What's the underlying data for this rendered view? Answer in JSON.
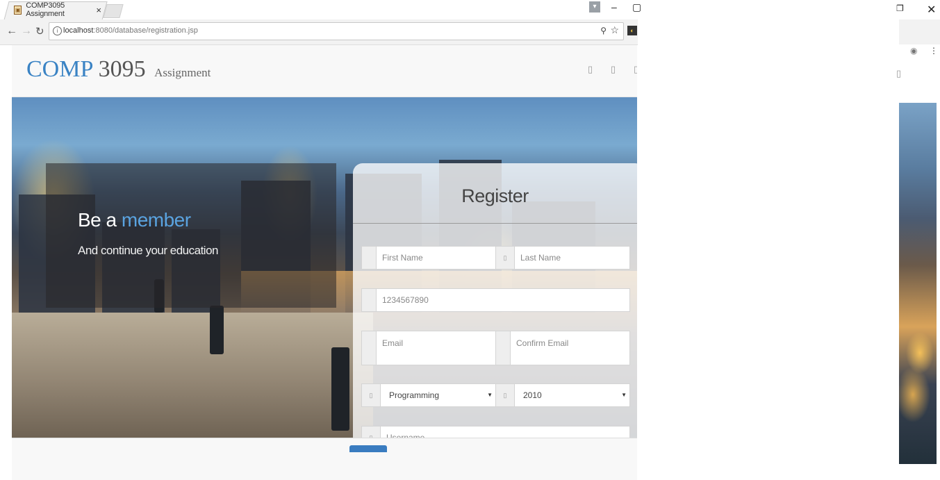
{
  "browser": {
    "tab_title": "COMP3095 Assignment",
    "url_host": "localhost",
    "url_rest": ":8080/database/registration.jsp"
  },
  "navbar": {
    "brand_part1": "COMP",
    "brand_part2": "3095",
    "brand_small": "Assignment"
  },
  "promo": {
    "title_lead": "Be a",
    "title_highlight": "member",
    "subtitle": "And continue your education"
  },
  "form": {
    "title": "Register",
    "first_name_placeholder": "First Name",
    "last_name_placeholder": "Last Name",
    "phone_placeholder": "1234567890",
    "email_placeholder": "Email",
    "confirm_email_placeholder": "Confirm Email",
    "program_value": "Programming",
    "year_value": "2010",
    "username_placeholder": "Username"
  },
  "colors": {
    "brand_accent": "#3a83c4",
    "highlight": "#5aa3e0",
    "button": "#3a7cc0"
  },
  "icons": {
    "back": "back-arrow-icon",
    "forward": "forward-arrow-icon",
    "reload": "reload-icon",
    "info": "info-icon",
    "zoom": "zoom-icon",
    "bookmark": "star-icon"
  }
}
